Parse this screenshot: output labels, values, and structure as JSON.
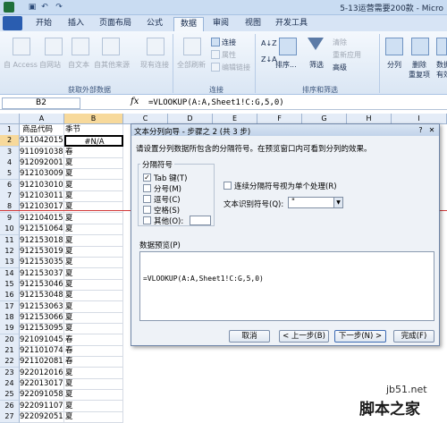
{
  "window": {
    "title": "5-13运营需要200款 - Micro"
  },
  "qat": {
    "save_icon": "save-icon",
    "undo_icon": "undo-icon",
    "redo_icon": "redo-icon"
  },
  "tabs": [
    "开始",
    "插入",
    "页面布局",
    "公式",
    "数据",
    "审阅",
    "视图",
    "开发工具"
  ],
  "active_tab": "数据",
  "ribbon": {
    "external": {
      "access": "自 Access",
      "web": "自网站",
      "text": "自文本",
      "other": "自其他来源",
      "existing": "现有连接",
      "group": "获取外部数据"
    },
    "connections": {
      "refresh": "全部刷新",
      "conn": "连接",
      "props": "属性",
      "edit": "编辑链接",
      "group": "连接"
    },
    "sortfilter": {
      "sort": "排序...",
      "filter": "筛选",
      "clear": "清除",
      "reapply": "重新应用",
      "advanced": "高级",
      "group": "排序和筛选"
    },
    "tools": {
      "split": "分列",
      "remove": "删除",
      "remove2": "重复项",
      "valid": "数据",
      "valid2": "有效"
    }
  },
  "formula_bar": {
    "name_box": "B2",
    "fx": "fx",
    "formula": "=VLOOKUP(A:A,Sheet1!C:G,5,0)"
  },
  "columns": [
    "A",
    "B",
    "C",
    "D",
    "E",
    "F",
    "G",
    "H",
    "I"
  ],
  "rows": [
    {
      "n": "1",
      "a": "商品代码",
      "b": "季节"
    },
    {
      "n": "2",
      "a": "911042015",
      "b": "#N/A"
    },
    {
      "n": "3",
      "a": "911091038",
      "b": "春"
    },
    {
      "n": "4",
      "a": "912092001",
      "b": "夏"
    },
    {
      "n": "5",
      "a": "912103009",
      "b": "夏"
    },
    {
      "n": "6",
      "a": "912103010",
      "b": "夏"
    },
    {
      "n": "7",
      "a": "912103011",
      "b": "夏"
    },
    {
      "n": "8",
      "a": "912103017",
      "b": "夏"
    },
    {
      "n": "9",
      "a": "912104015",
      "b": "夏"
    },
    {
      "n": "10",
      "a": "912151064",
      "b": "夏"
    },
    {
      "n": "11",
      "a": "912153018",
      "b": "夏"
    },
    {
      "n": "12",
      "a": "912153019",
      "b": "夏"
    },
    {
      "n": "13",
      "a": "912153035",
      "b": "夏"
    },
    {
      "n": "14",
      "a": "912153037",
      "b": "夏"
    },
    {
      "n": "15",
      "a": "912153046",
      "b": "夏"
    },
    {
      "n": "16",
      "a": "912153048",
      "b": "夏"
    },
    {
      "n": "17",
      "a": "912153063",
      "b": "夏"
    },
    {
      "n": "18",
      "a": "912153066",
      "b": "夏"
    },
    {
      "n": "19",
      "a": "912153095",
      "b": "夏"
    },
    {
      "n": "20",
      "a": "921091045",
      "b": "春"
    },
    {
      "n": "21",
      "a": "921101074",
      "b": "春"
    },
    {
      "n": "22",
      "a": "921102081",
      "b": "春"
    },
    {
      "n": "23",
      "a": "922012016",
      "b": "夏"
    },
    {
      "n": "24",
      "a": "922013017",
      "b": "夏"
    },
    {
      "n": "25",
      "a": "922091058",
      "b": "夏"
    },
    {
      "n": "26",
      "a": "922091107",
      "b": "夏"
    },
    {
      "n": "27",
      "a": "922092051",
      "b": "夏"
    }
  ],
  "dialog": {
    "title": "文本分列向导 - 步骤之 2 (共 3 步)",
    "instruction": "请设置分列数据所包含的分隔符号。在预览窗口内可看到分列的效果。",
    "delimiters_label": "分隔符号",
    "tab": "Tab 键(T)",
    "semicolon": "分号(M)",
    "comma": "逗号(C)",
    "space": "空格(S)",
    "other": "其他(O):",
    "other_value": "",
    "consecutive": "连续分隔符号视为单个处理(R)",
    "qualifier_label": "文本识别符号(Q):",
    "qualifier_value": "\"",
    "preview_label": "数据预览(P)",
    "preview_text": "=VLOOKUP(A:A,Sheet1!C:G,5,0)",
    "cancel": "取消",
    "back": "< 上一步(B)",
    "next": "下一步(N) >",
    "finish": "完成(F)",
    "tab_checked": true
  },
  "watermark": {
    "site": "jb51.net",
    "brand": "脚本之家"
  }
}
